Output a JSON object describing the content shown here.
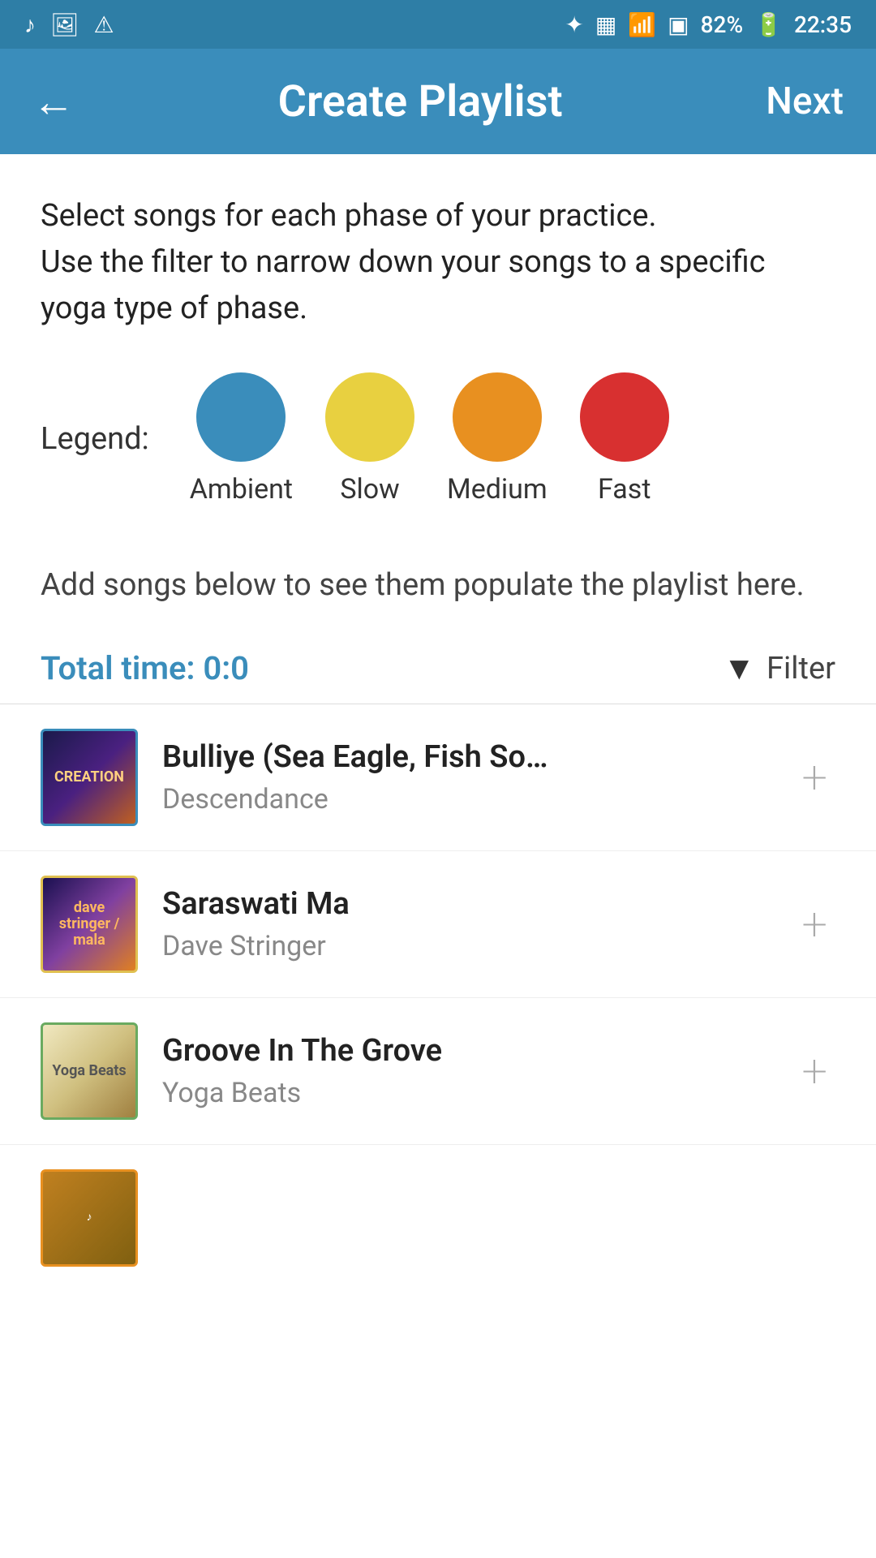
{
  "statusBar": {
    "leftIcons": [
      "music-icon",
      "image-icon",
      "alert-icon"
    ],
    "battery": "82%",
    "time": "22:35",
    "wifiIcon": "wifi-icon",
    "bluetoothIcon": "bluetooth-icon",
    "batteryIcon": "battery-icon"
  },
  "header": {
    "backLabel": "←",
    "title": "Create Playlist",
    "nextLabel": "Next"
  },
  "instructions": {
    "line1": "Select songs for each phase of your practice.",
    "line2": "Use the filter to narrow down your songs to a specific yoga type of phase."
  },
  "legend": {
    "label": "Legend:",
    "items": [
      {
        "name": "Ambient",
        "color": "#3a8dbb"
      },
      {
        "name": "Slow",
        "color": "#e8d040"
      },
      {
        "name": "Medium",
        "color": "#e89020"
      },
      {
        "name": "Fast",
        "color": "#d83030"
      }
    ]
  },
  "addSongsNote": "Add songs below to see them populate the playlist here.",
  "toolbar": {
    "totalTimeLabel": "Total time: 0:0",
    "filterLabel": "Filter"
  },
  "songs": [
    {
      "id": 1,
      "title": "Bulliye (Sea Eagle, Fish So…",
      "artist": "Descendance",
      "artworkLabel": "CREATION",
      "artworkClass": "artwork-creation",
      "borderClass": "blue-border"
    },
    {
      "id": 2,
      "title": "Saraswati Ma",
      "artist": "Dave Stringer",
      "artworkLabel": "dave stringer / mala",
      "artworkClass": "artwork-dave",
      "borderClass": "yellow-border"
    },
    {
      "id": 3,
      "title": "Groove In The Grove",
      "artist": "Yoga Beats",
      "artworkLabel": "Yoga Beats",
      "artworkClass": "artwork-yoga",
      "borderClass": "green-border"
    }
  ]
}
